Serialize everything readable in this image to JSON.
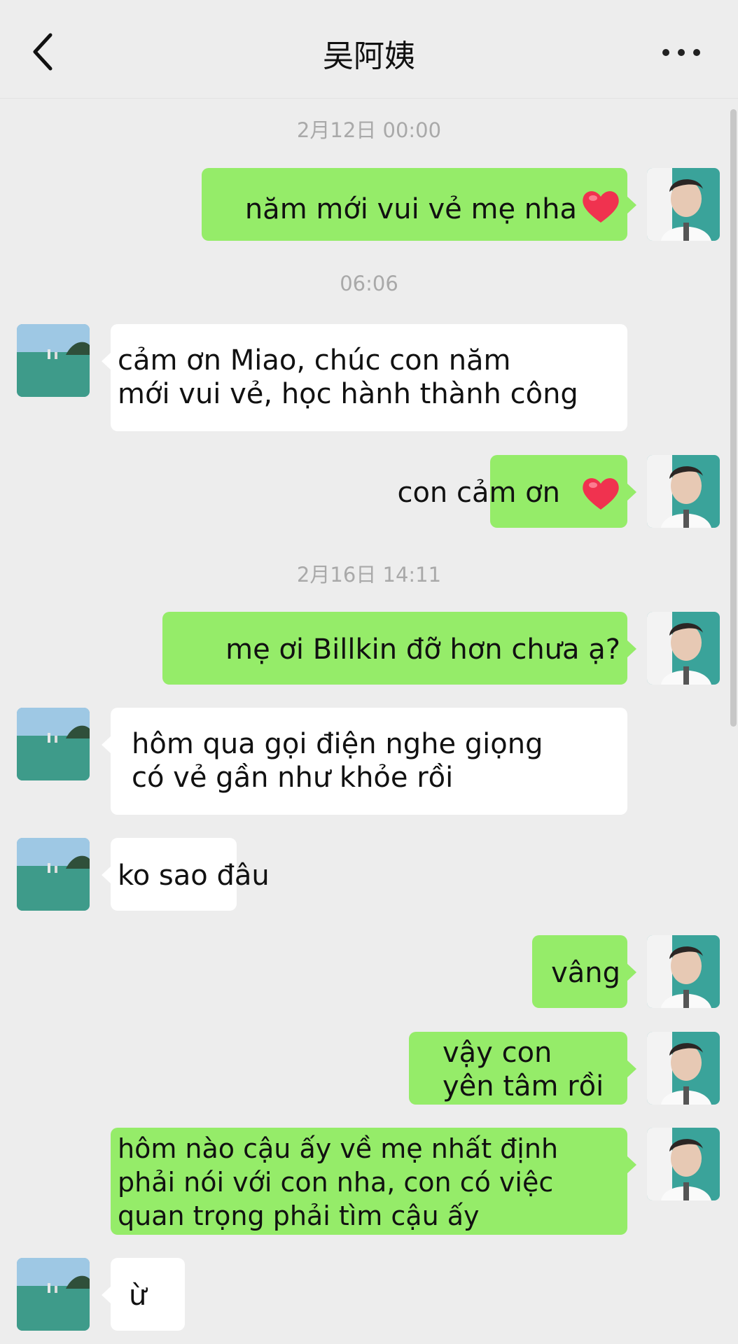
{
  "header": {
    "title": "吴阿姨",
    "back_icon": "chevron-left-icon",
    "more_icon": "more-dots-icon"
  },
  "timestamps": [
    "2月12日 00:00",
    "06:06",
    "2月16日 14:11"
  ],
  "messages": [
    {
      "side": "sent",
      "text": "năm mới vui vẻ mẹ nha",
      "icon": "heart-icon"
    },
    {
      "side": "recv",
      "text": "cảm ơn Miao, chúc con năm\nmới vui vẻ, học hành thành công"
    },
    {
      "side": "sent",
      "text": "con cảm ơn",
      "icon": "heart-icon"
    },
    {
      "side": "sent",
      "text": "mẹ ơi Billkin đỡ hơn chưa ạ?"
    },
    {
      "side": "recv",
      "text": "hôm qua gọi điện nghe giọng\ncó vẻ gần như khỏe rồi"
    },
    {
      "side": "recv",
      "text": "ko sao đâu"
    },
    {
      "side": "sent",
      "text": "vâng"
    },
    {
      "side": "sent",
      "text": "vậy con\nyên tâm rồi"
    },
    {
      "side": "sent",
      "text": "hôm nào cậu ấy về mẹ nhất định\nphải nói với con nha, con có việc\nquan trọng phải tìm cậu ấy"
    },
    {
      "side": "recv",
      "text": "ừ"
    }
  ],
  "colors": {
    "background": "#ededed",
    "sent_bubble": "#95ec69",
    "received_bubble": "#ffffff",
    "timestamp_text": "#a9a9a9",
    "heart": "#f0324f"
  }
}
